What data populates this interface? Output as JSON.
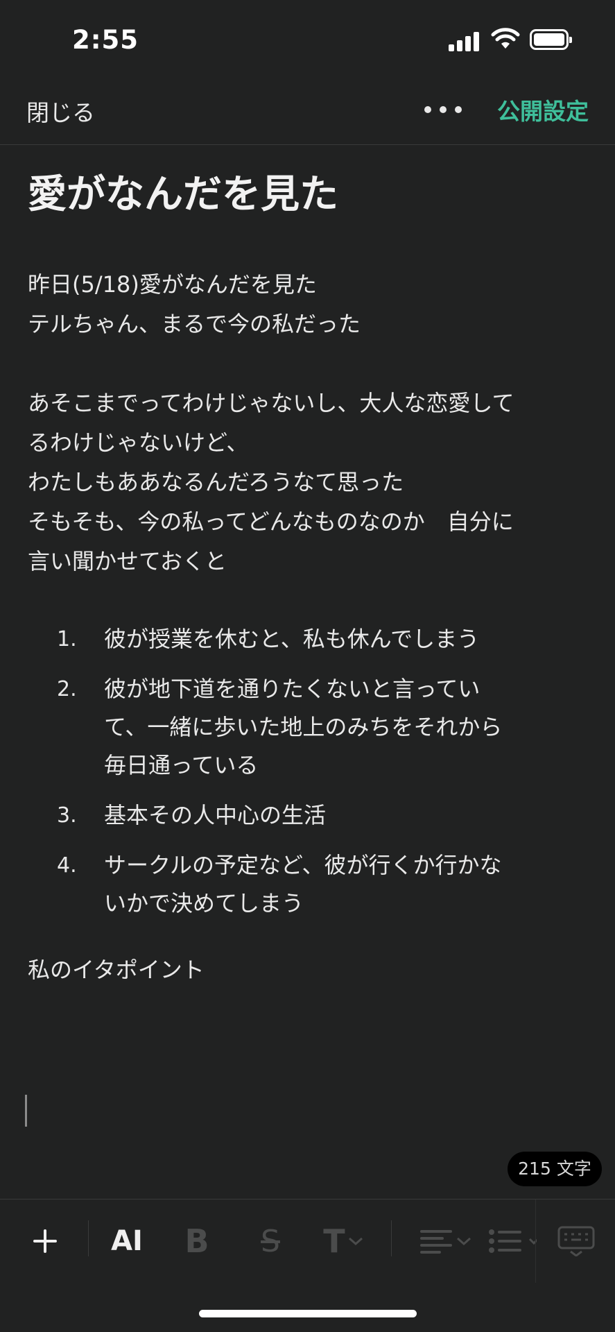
{
  "status": {
    "time": "2:55"
  },
  "nav": {
    "close_label": "閉じる",
    "more_icon": "more-icon",
    "publish_label": "公開設定",
    "accent_color": "#3fbf9b"
  },
  "editor": {
    "title": "愛がなんだを見た",
    "paragraph1": [
      "昨日(5/18)愛がなんだを見た",
      "テルちゃん、まるで今の私だった"
    ],
    "paragraph2": [
      "あそこまでってわけじゃないし、大人な恋愛して",
      "るわけじゃないけど、",
      "わたしもああなるんだろうなて思った",
      "そもそも、今の私ってどんなものなのか　自分に",
      "言い聞かせておくと"
    ],
    "list": [
      {
        "num": "1.",
        "lines": [
          "彼が授業を休むと、私も休んでしまう"
        ]
      },
      {
        "num": "2.",
        "lines": [
          "彼が地下道を通りたくないと言ってい",
          "て、一緒に歩いた地上のみちをそれから",
          "毎日通っている"
        ]
      },
      {
        "num": "3.",
        "lines": [
          "基本その人中心の生活"
        ]
      },
      {
        "num": "4.",
        "lines": [
          "サークルの予定など、彼が行くか行かな",
          "いかで決めてしまう"
        ]
      }
    ],
    "paragraph3": "私のイタポイント",
    "char_count": "215 文字"
  },
  "toolbar": {
    "add_icon": "plus-icon",
    "ai_label": "AI",
    "bold_label": "B",
    "strike_label": "S",
    "text_size_label": "T",
    "align_icon": "align-left-icon",
    "list_icon": "bullet-list-icon",
    "keyboard_icon": "keyboard-icon"
  }
}
